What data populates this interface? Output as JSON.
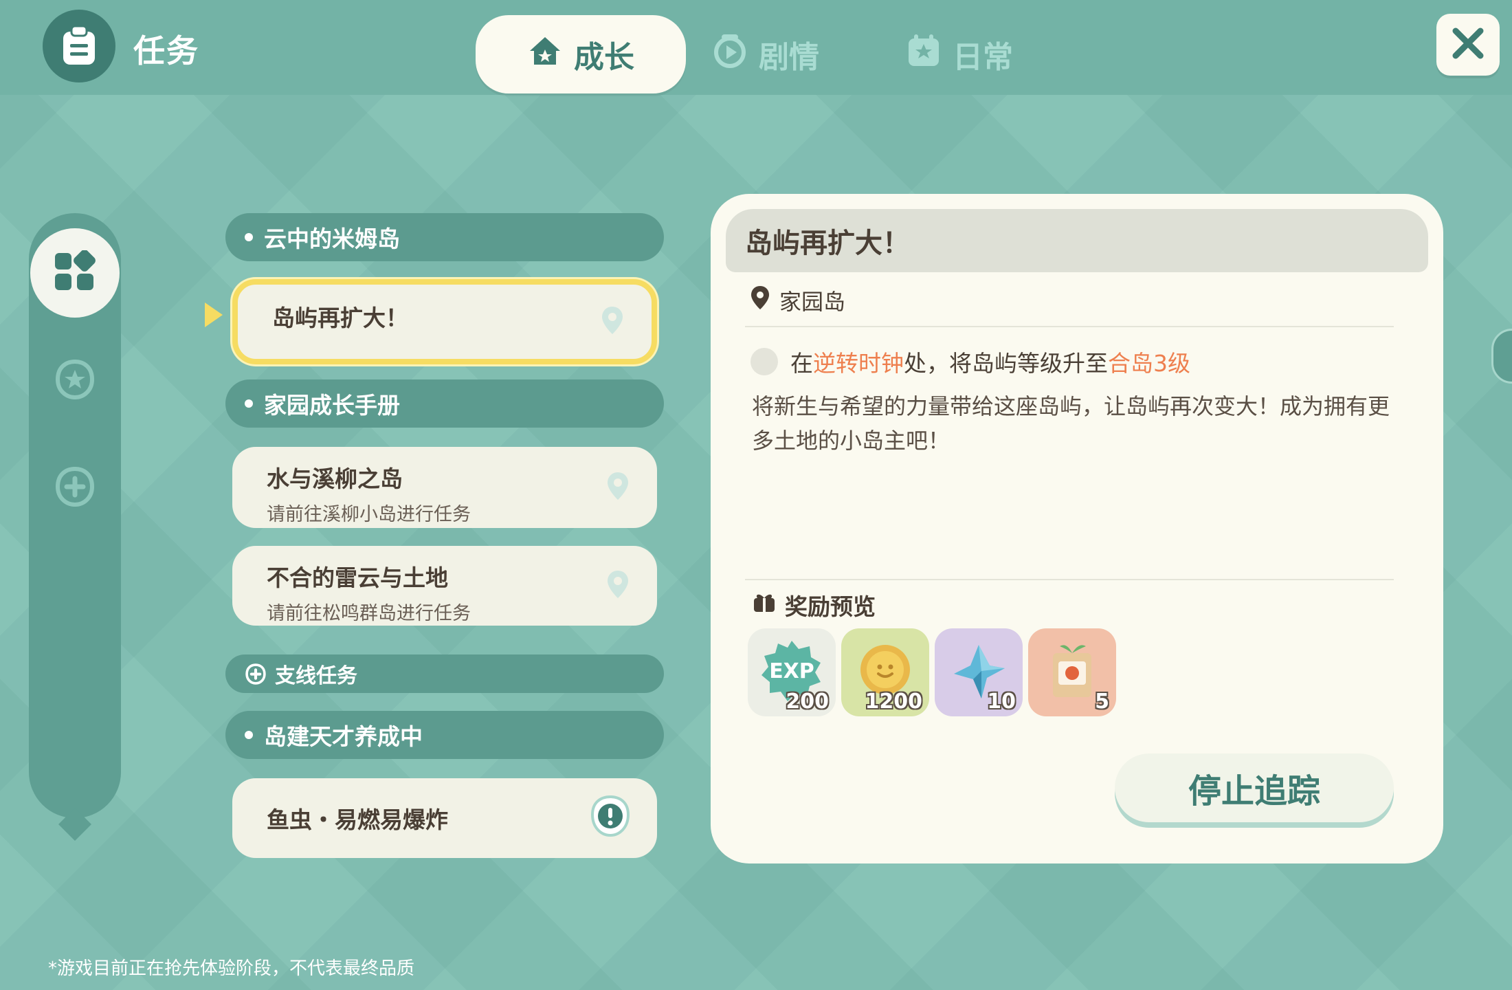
{
  "header": {
    "title": "任务",
    "tabs": [
      {
        "label": "成长",
        "active": true,
        "icon": "house-icon"
      },
      {
        "label": "剧情",
        "active": false,
        "icon": "play-icon"
      },
      {
        "label": "日常",
        "active": false,
        "icon": "star-calendar-icon"
      }
    ],
    "close_icon": "close-icon"
  },
  "sidebar": {
    "items": [
      {
        "icon": "grid-icon",
        "active": true
      },
      {
        "icon": "star-badge-icon",
        "active": false
      },
      {
        "icon": "plus-badge-icon",
        "active": false
      },
      {
        "icon": "diamond-icon",
        "active": false
      }
    ]
  },
  "quests": {
    "group1": {
      "title": "云中的米姆岛"
    },
    "selected": {
      "title": "岛屿再扩大！"
    },
    "group2": {
      "title": "家园成长手册"
    },
    "item2": {
      "title": "水与溪柳之岛",
      "sub": "请前往溪柳小岛进行任务"
    },
    "item3": {
      "title": "不合的雷云与土地",
      "sub": "请前往松鸣群岛进行任务"
    },
    "section_side": {
      "title": "支线任务"
    },
    "group3": {
      "title": "岛建天才养成中"
    },
    "item4": {
      "title": "鱼虫・易燃易爆炸"
    }
  },
  "detail": {
    "title": "岛屿再扩大！",
    "location": "家园岛",
    "objective": {
      "prefix": "在",
      "highlight1": "逆转时钟",
      "middle": "处，将岛屿等级升至",
      "highlight2": "合岛3级"
    },
    "description": "将新生与希望的力量带给这座岛屿，让岛屿再次变大！成为拥有更多土地的小岛主吧！",
    "reward_label": "奖励预览",
    "rewards": [
      {
        "name": "EXP",
        "qty": "200",
        "icon": "exp-badge-icon",
        "bg": "#eceee6"
      },
      {
        "name": "coin",
        "qty": "1200",
        "icon": "gold-coin-icon",
        "bg": "#d8e4a6"
      },
      {
        "name": "crystal",
        "qty": "10",
        "icon": "blue-crystal-icon",
        "bg": "#d8cce8"
      },
      {
        "name": "seed-pack",
        "qty": "5",
        "icon": "seed-packet-icon",
        "bg": "#f2c0a8"
      }
    ],
    "stop_button": "停止追踪"
  },
  "footer": {
    "note": "*游戏目前正在抢先体验阶段，不代表最终品质"
  },
  "colors": {
    "background": "#7fbfb2",
    "accent": "#3f7d73",
    "highlight": "#ee7f4e",
    "selected_border": "#f6dc62",
    "panel": "#fbfaf0"
  }
}
